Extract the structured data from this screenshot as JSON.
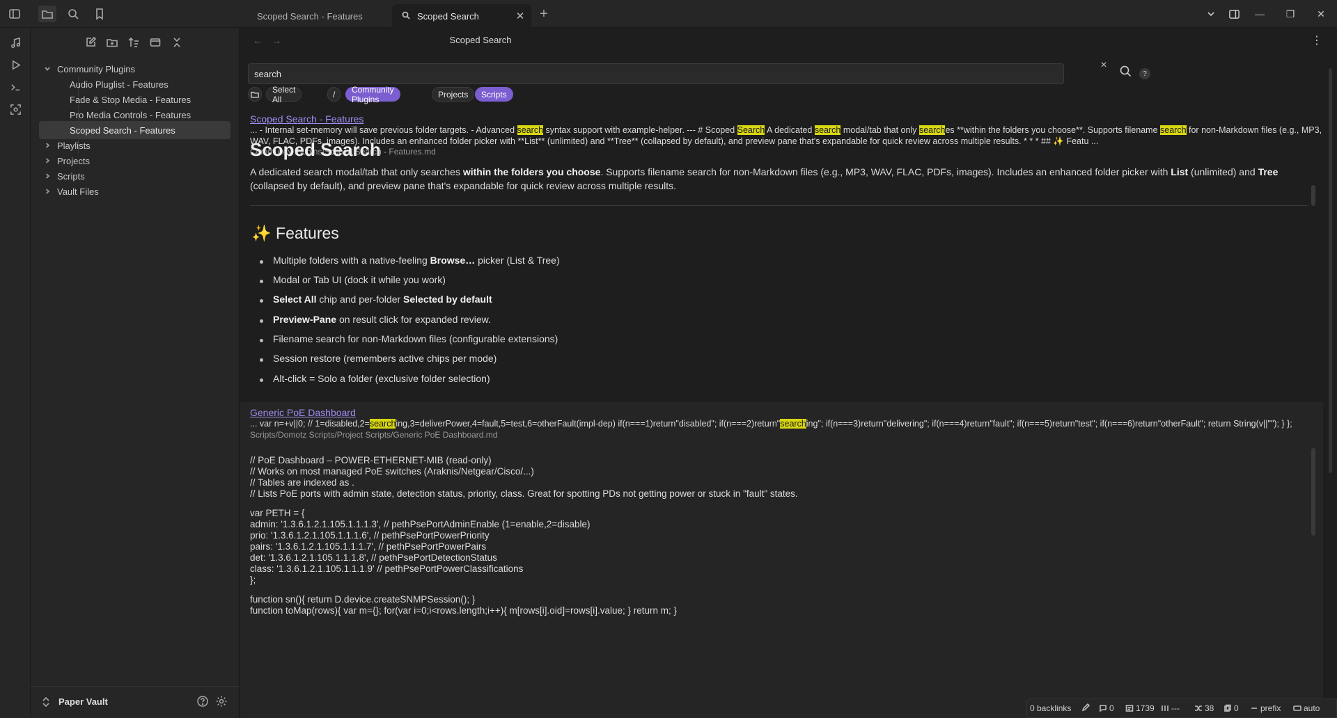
{
  "tabs": [
    {
      "label": "Scoped Search - Features",
      "active": false
    },
    {
      "label": "Scoped Search",
      "active": true
    }
  ],
  "sidebar": {
    "tree": [
      {
        "label": "Community Plugins",
        "type": "folder",
        "expanded": true
      },
      {
        "label": "Audio Pluglist - Features",
        "type": "file"
      },
      {
        "label": "Fade & Stop Media - Features",
        "type": "file"
      },
      {
        "label": "Pro Media Controls - Features",
        "type": "file"
      },
      {
        "label": "Scoped Search - Features",
        "type": "file",
        "selected": true
      },
      {
        "label": "Playlists",
        "type": "folder"
      },
      {
        "label": "Projects",
        "type": "folder"
      },
      {
        "label": "Scripts",
        "type": "folder"
      },
      {
        "label": "Vault Files",
        "type": "folder"
      }
    ],
    "vault_name": "Paper Vault"
  },
  "view": {
    "title": "Scoped Search"
  },
  "search": {
    "value": "search",
    "clear_label": "×",
    "help_label": "?"
  },
  "chips": {
    "select_all": "Select All",
    "root": "/",
    "items": [
      {
        "label": "Community Plugins",
        "selected": true
      },
      {
        "label": "Projects",
        "selected": false
      },
      {
        "label": "Scripts",
        "selected": true
      }
    ]
  },
  "results": [
    {
      "title": "Scoped Search - Features",
      "snippet_parts": [
        {
          "t": "... - Internal set-memory will save previous folder targets. - Advanced "
        },
        {
          "m": "search"
        },
        {
          "t": " syntax support with example-helper. --- # Scoped "
        },
        {
          "m": "Search"
        },
        {
          "t": " A dedicated "
        },
        {
          "m": "search"
        },
        {
          "t": " modal/tab that only "
        },
        {
          "m": "search"
        },
        {
          "t": "es **within the folders you choose**. Supports filename "
        },
        {
          "m": "search"
        },
        {
          "t": " for non-Markdown files (e.g., MP3, WAV, FLAC, PDFs, images). Includes an enhanced folder picker with **List** (unlimited) and **Tree** (collapsed by default), and preview pane that's expandable for quick review across multiple results. * * * ## ✨ Featu ..."
        }
      ],
      "path": "Community Plugins/Scoped Search - Features.md",
      "preview": {
        "h1": "Scoped Search",
        "intro_parts": [
          {
            "t": "A dedicated search modal/tab that only searches "
          },
          {
            "b": "within the folders you choose"
          },
          {
            "t": ". Supports filename search for non-Markdown files (e.g., MP3, WAV, FLAC, PDFs, images). Includes an enhanced folder picker with "
          },
          {
            "b": "List"
          },
          {
            "t": " (unlimited) and "
          },
          {
            "b": "Tree"
          },
          {
            "t": " (collapsed by default), and preview pane that's expandable for quick review across multiple results."
          }
        ],
        "h2": "✨ Features",
        "bullets": [
          [
            {
              "t": "Multiple folders with a native-feeling "
            },
            {
              "b": "Browse…"
            },
            {
              "t": " picker (List & Tree)"
            }
          ],
          [
            {
              "t": "Modal or Tab UI (dock it while you work)"
            }
          ],
          [
            {
              "b": "Select All"
            },
            {
              "t": " chip and per-folder "
            },
            {
              "b": "Selected by default"
            }
          ],
          [
            {
              "b": "Preview-Pane"
            },
            {
              "t": " on result click for expanded review."
            }
          ],
          [
            {
              "t": "Filename search for non-Markdown files (configurable extensions)"
            }
          ],
          [
            {
              "t": "Session restore (remembers active chips per mode)"
            }
          ],
          [
            {
              "t": "Alt-click = Solo a folder (exclusive folder selection)"
            }
          ]
        ]
      }
    },
    {
      "title": "Generic PoE Dashboard",
      "snippet_parts": [
        {
          "t": "... var n=+v||0; // 1=disabled,2="
        },
        {
          "m": "search"
        },
        {
          "t": "ing,3=deliverPower,4=fault,5=test,6=otherFault(impl-dep) if(n===1)return\"disabled\"; if(n===2)return\""
        },
        {
          "m": "search"
        },
        {
          "t": "ing\"; if(n===3)return\"delivering\"; if(n===4)return\"fault\"; if(n===5)return\"test\"; if(n===6)return\"otherFault\"; return String(v||\"\"); } };"
        }
      ],
      "path": "Scripts/Domotz Scripts/Project Scripts/Generic PoE Dashboard.md",
      "code": [
        "// PoE Dashboard – POWER-ETHERNET-MIB (read-only)",
        "// Works on most managed PoE switches (Araknis/Netgear/Cisco/...)",
        "// Tables are indexed as .",
        "// Lists PoE ports with admin state, detection status, priority, class. Great for spotting PDs not getting power or stuck in \"fault\" states.",
        "var PETH = {",
        "admin: '1.3.6.1.2.1.105.1.1.1.3', // pethPsePortAdminEnable (1=enable,2=disable)",
        "prio: '1.3.6.1.2.1.105.1.1.1.6', // pethPsePortPowerPriority",
        "pairs: '1.3.6.1.2.1.105.1.1.1.7', // pethPsePortPowerPairs",
        "det: '1.3.6.1.2.1.105.1.1.1.8', // pethPsePortDetectionStatus",
        "class: '1.3.6.1.2.1.105.1.1.1.9' // pethPsePortPowerClassifications",
        "};",
        "function sn(){ return D.device.createSNMPSession(); }",
        "function toMap(rows){ var m={}; for(var i=0;i<rows.length;i++){ m[rows[i].oid]=rows[i].value; } return m; }"
      ]
    }
  ],
  "status": {
    "backlinks": "0 backlinks",
    "edit_count": "0",
    "words": "1739",
    "chars": "---",
    "lines": "38",
    "zero": "0",
    "prefix": "prefix",
    "auto": "auto"
  }
}
